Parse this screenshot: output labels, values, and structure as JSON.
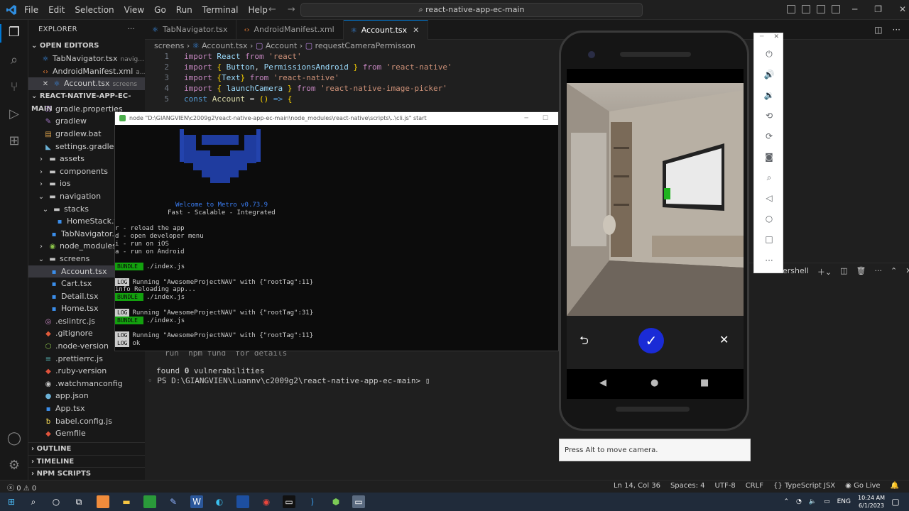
{
  "titlebar": {
    "menu": [
      "File",
      "Edit",
      "Selection",
      "View",
      "Go",
      "Run",
      "Terminal",
      "Help"
    ],
    "search": "react-native-app-ec-main"
  },
  "sidebar": {
    "header": "EXPLORER",
    "open_editors_label": "OPEN EDITORS",
    "open_editors": [
      {
        "name": "TabNavigator.tsx",
        "hint": "navig..."
      },
      {
        "name": "AndroidManifest.xml",
        "hint": "a..."
      },
      {
        "name": "Account.tsx",
        "hint": "screens"
      }
    ],
    "project_label": "REACT-NATIVE-APP-EC-MAIN",
    "tree": [
      "gradle.properties",
      "gradlew",
      "gradlew.bat",
      "settings.gradle",
      "assets",
      "components",
      "ios",
      "navigation",
      "stacks",
      "HomeStack.tsx",
      "TabNavigator.tsx",
      "node_modules",
      "screens",
      "Account.tsx",
      "Cart.tsx",
      "Detail.tsx",
      "Home.tsx",
      ".eslintrc.js",
      ".gitignore",
      ".node-version",
      ".prettierrc.js",
      ".ruby-version",
      ".watchmanconfig",
      "app.json",
      "App.tsx",
      "babel.config.js",
      "Gemfile"
    ],
    "outline": "OUTLINE",
    "timeline": "TIMELINE",
    "npm_scripts": "NPM SCRIPTS"
  },
  "tabs": [
    {
      "label": "TabNavigator.tsx"
    },
    {
      "label": "AndroidManifest.xml"
    },
    {
      "label": "Account.tsx"
    }
  ],
  "breadcrumb": [
    "screens",
    "Account.tsx",
    "Account",
    "requestCameraPermisson"
  ],
  "code": {
    "line_numbers": [
      "1",
      "2",
      "3",
      "4",
      "5"
    ]
  },
  "metro": {
    "title": "node \"D:\\GIANGVIEN\\c2009g2\\react-native-app-ec-main\\node_modules\\react-native\\scripts\\..\\cli.js\" start",
    "welcome": "Welcome to Metro v0.73.9",
    "tagline": "Fast - Scalable - Integrated",
    "commands": [
      "r - reload the app",
      "d - open developer menu",
      "i - run on iOS",
      "a - run on Android"
    ],
    "bundle_label": "BUNDLE",
    "log_label": "LOG",
    "bundle_file": "./index.js",
    "log1": "Running \"AwesomeProjectNAV\" with {\"rootTag\":11}",
    "info": "info Reloading app...",
    "log2": "Running \"AwesomeProjectNAV\" with {\"rootTag\":31}",
    "log3": "Running \"AwesomeProjectNAV\" with {\"rootTag\":11}",
    "log4": "ok"
  },
  "terminal": {
    "partial": "run `npm fund` for details",
    "found": "found ",
    "found_count": "0",
    "found_rest": " vulnerabilities",
    "prompt": "PS D:\\GIANGVIEN\\Luannv\\c2009g2\\react-native-app-ec-main> ",
    "shell": "ershell"
  },
  "emulator": {
    "tooltip": "Press Alt to move camera."
  },
  "statusbar": {
    "errors": "0",
    "warnings": "0",
    "position": "Ln 14, Col 36",
    "spaces": "Spaces: 4",
    "encoding": "UTF-8",
    "eol": "CRLF",
    "language": "TypeScript JSX",
    "golive": "Go Live"
  },
  "taskbar": {
    "lang": "ENG",
    "time": "10:24 AM",
    "date": "6/1/2023"
  },
  "colors": {
    "accent": "#0078d4",
    "bundle": "#13a10e",
    "confirm_button": "#1a2bd6"
  }
}
